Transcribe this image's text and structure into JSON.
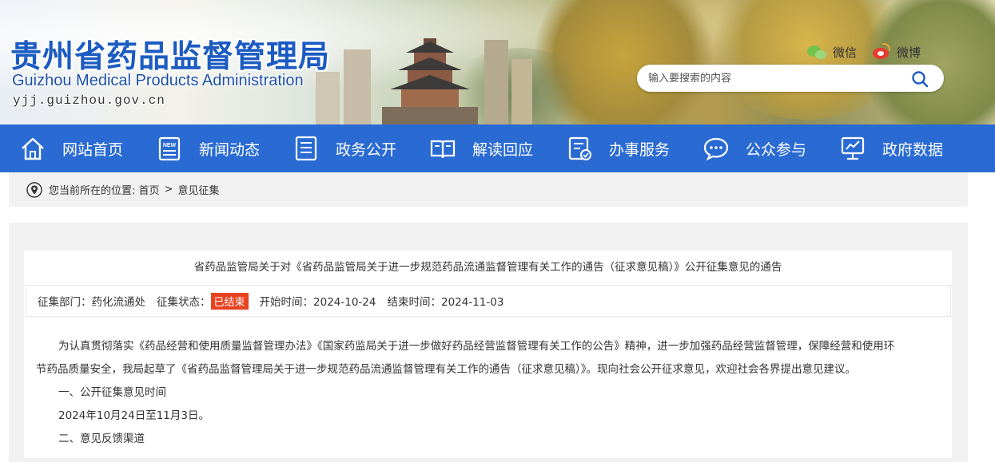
{
  "header": {
    "logo_cn": "贵州省药品监督管理局",
    "logo_en": "Guizhou Medical Products Administration",
    "logo_url": "yjj.guizhou.gov.cn",
    "social": {
      "wechat": "微信",
      "weibo": "微博"
    },
    "search_placeholder": "输入要搜索的内容"
  },
  "nav": {
    "items": [
      {
        "label": "网站首页",
        "icon": "home-icon"
      },
      {
        "label": "新闻动态",
        "icon": "news-icon"
      },
      {
        "label": "政务公开",
        "icon": "document-icon"
      },
      {
        "label": "解读回应",
        "icon": "book-icon"
      },
      {
        "label": "办事服务",
        "icon": "service-icon"
      },
      {
        "label": "公众参与",
        "icon": "chat-icon"
      },
      {
        "label": "政府数据",
        "icon": "data-icon"
      }
    ]
  },
  "breadcrumb": {
    "prefix": "您当前所在的位置:",
    "home": "首页",
    "separator": ">",
    "current": "意见征集"
  },
  "article": {
    "title": "省药品监管局关于对《省药品监管局关于进一步规范药品流通监督管理有关工作的通告（征求意见稿）》公开征集意见的通告",
    "meta": {
      "dept_label": "征集部门：药化流通处",
      "status_label": "征集状态：",
      "status_value": "已结束",
      "start_label": "开始时间：2024-10-24",
      "end_label": "结束时间：2024-11-03"
    },
    "paragraph1_line1": "为认真贯彻落实《药品经营和使用质量监督管理办法》《国家药监局关于进一步做好药品经营监督管理有关工作的公告》精神，进一步加强药品经营监督管理，保障经营和使用环",
    "paragraph1_line2": "节药品质量安全，我局起草了《省药品监督管理局关于进一步规范药品流通监督管理有关工作的通告（征求意见稿）》。现向社会公开征求意见，欢迎社会各界提出意见建议。",
    "section1_heading": "一、公开征集意见时间",
    "section1_text": "2024年10月24日至11月3日。",
    "section2_heading": "二、意见反馈渠道"
  },
  "colors": {
    "nav_bg": "#2a6bd3",
    "logo_blue": "#1c5bc2",
    "status_red": "#e8421f",
    "panel_bg": "#f1f1f1"
  }
}
